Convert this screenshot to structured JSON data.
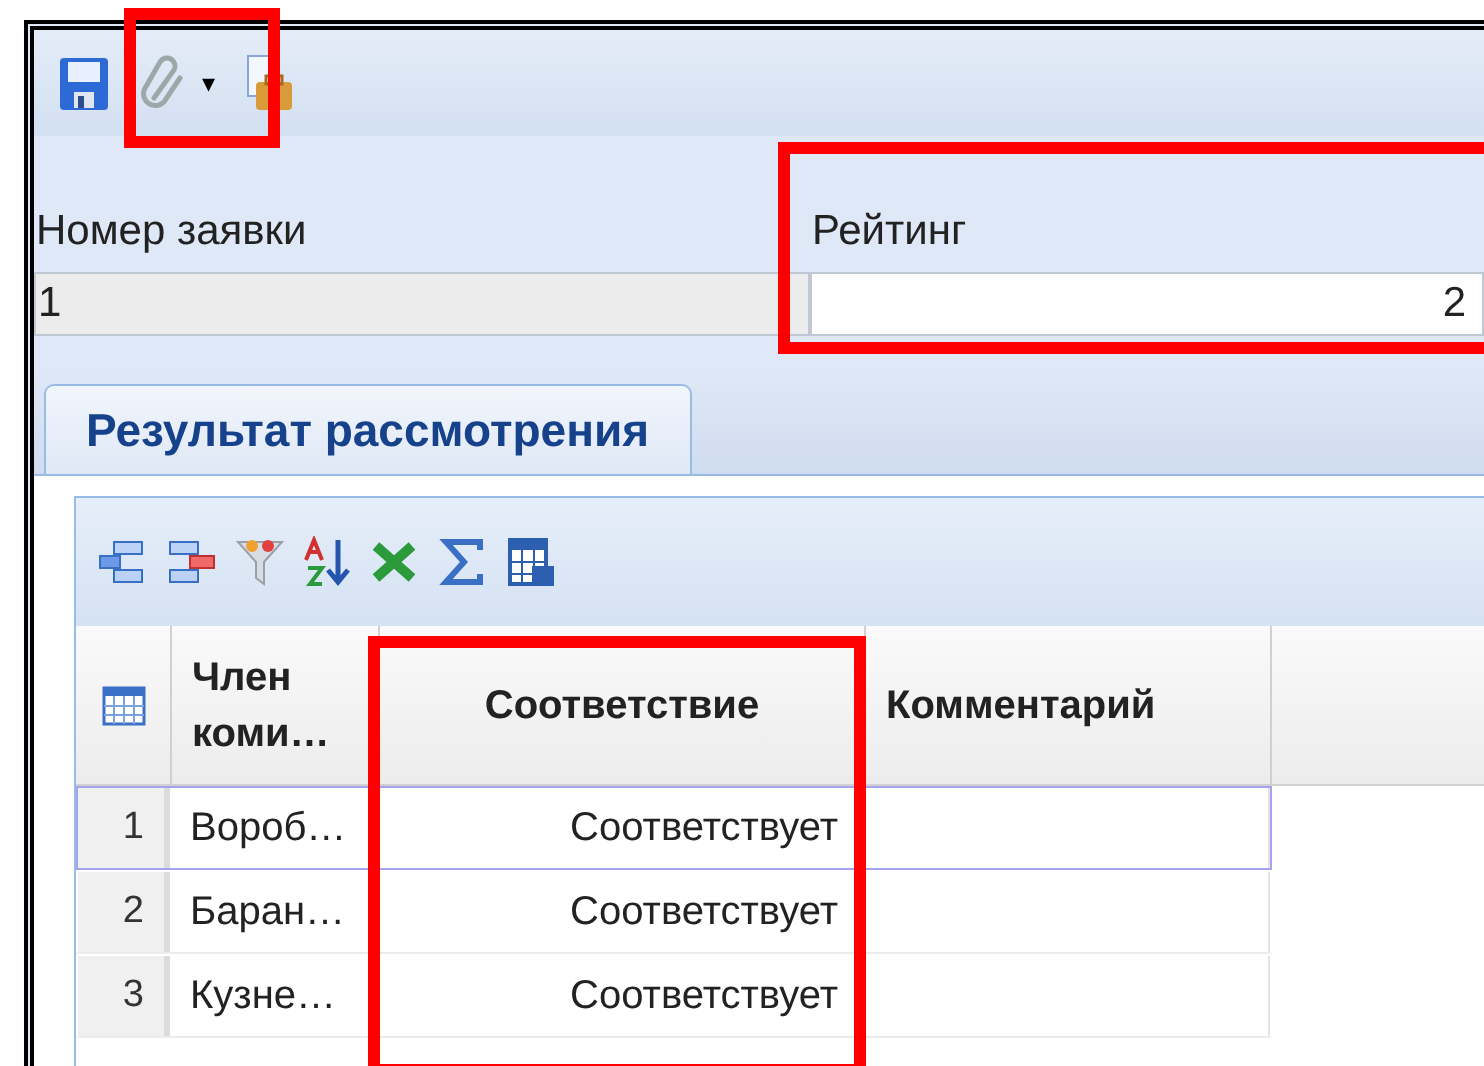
{
  "toolbar": {
    "buttons": [
      {
        "kind": "save",
        "highlighted": false
      },
      {
        "kind": "attach",
        "highlighted": true,
        "dropdown": "▾"
      },
      {
        "kind": "report",
        "highlighted": false
      }
    ]
  },
  "form": {
    "fields": [
      {
        "label": "Номер заявки",
        "value": "1",
        "editable": false,
        "highlighted": false
      },
      {
        "label": "Рейтинг",
        "value": "2",
        "editable": true,
        "highlighted": true
      }
    ]
  },
  "tabs": [
    {
      "label": "Результат рассмотрения",
      "selected": true
    }
  ],
  "grid": {
    "tools": [
      {
        "kind": "add-row"
      },
      {
        "kind": "remove-row"
      },
      {
        "kind": "filter"
      },
      {
        "kind": "sort"
      },
      {
        "kind": "excel"
      },
      {
        "kind": "sum"
      },
      {
        "kind": "columns"
      }
    ],
    "columns": [
      {
        "label": "Член коми…",
        "highlighted": false
      },
      {
        "label": "Соответствие",
        "highlighted": true
      },
      {
        "label": "Комментарий",
        "highlighted": false
      }
    ],
    "rows": [
      {
        "number": "1",
        "selected": true,
        "cells": [
          "Вороб…",
          "Соответствует",
          ""
        ]
      },
      {
        "number": "2",
        "selected": false,
        "cells": [
          "Баран…",
          "Соответствует",
          ""
        ]
      },
      {
        "number": "3",
        "selected": false,
        "cells": [
          "Кузне…",
          "Соответствует",
          ""
        ]
      }
    ]
  }
}
